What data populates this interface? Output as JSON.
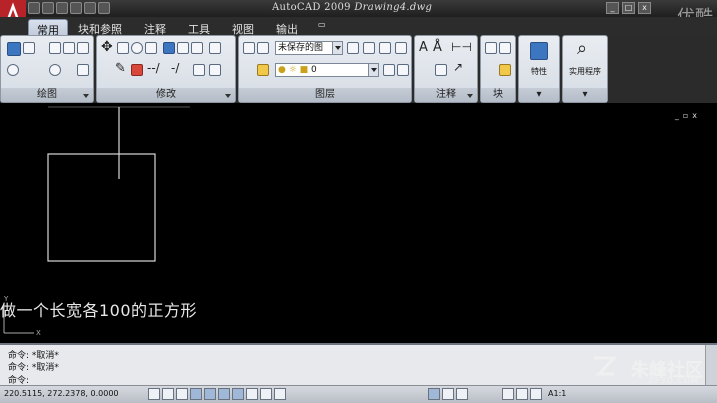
{
  "window": {
    "title_app": "AutoCAD 2009",
    "title_doc": "Drawing4.dwg",
    "controls": [
      "_",
      "□",
      "x"
    ]
  },
  "tabs": [
    {
      "label": "常用",
      "active": true
    },
    {
      "label": "块和参照",
      "active": false
    },
    {
      "label": "注释",
      "active": false
    },
    {
      "label": "工具",
      "active": false
    },
    {
      "label": "视图",
      "active": false
    },
    {
      "label": "输出",
      "active": false
    }
  ],
  "ribbon": {
    "panels": {
      "draw": "绘图",
      "modify": "修改",
      "layers": "图层",
      "annotation": "注释",
      "block": "块"
    },
    "layer_state_value": "未保存的图",
    "layer_value": "0",
    "properties_label": "特性",
    "utilities_label": "实用程序"
  },
  "canvas": {
    "subtitle": "做一个长宽各100的正方形",
    "ucs_x": "X",
    "ucs_y": "Y",
    "viewport_controls": [
      "_",
      "▫",
      "x"
    ]
  },
  "command": {
    "lines": [
      "命令: *取消*",
      "命令: *取消*",
      "命令:"
    ]
  },
  "status": {
    "coords": "220.5115,  272.2378,  0.0000",
    "annotation_scale": "A1:1",
    "colors": {
      "accent": "#3c76c0",
      "background": "#000000"
    }
  },
  "watermark": {
    "top": "优酷",
    "bottom": "朱峰社区",
    "bottom_sub": "ZF3D.COM"
  }
}
